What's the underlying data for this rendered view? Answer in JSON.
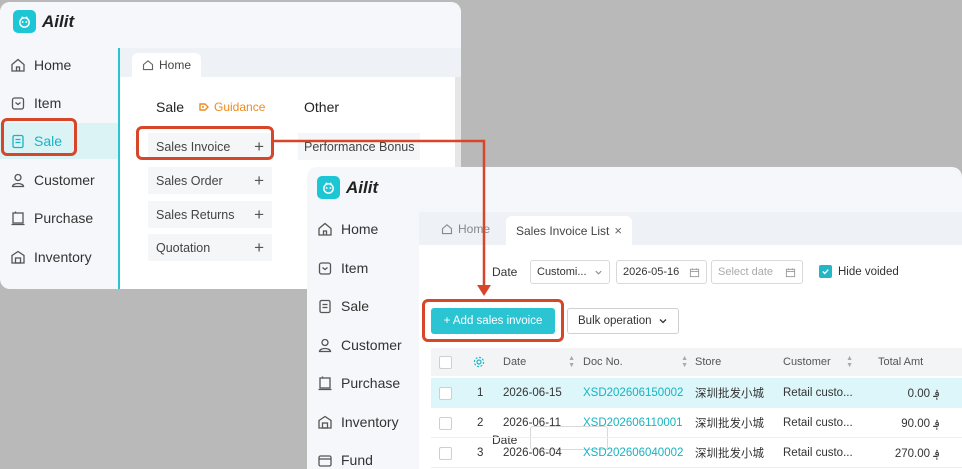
{
  "app": {
    "name": "Ailit"
  },
  "window1": {
    "nav": [
      {
        "label": "Home",
        "icon": "home-icon"
      },
      {
        "label": "Item",
        "icon": "item-icon"
      },
      {
        "label": "Sale",
        "icon": "sale-icon",
        "active": true
      },
      {
        "label": "Customer",
        "icon": "customer-icon"
      },
      {
        "label": "Purchase",
        "icon": "purchase-icon"
      },
      {
        "label": "Inventory",
        "icon": "inventory-icon"
      }
    ],
    "tab_home": "Home",
    "sale_heading": "Sale",
    "guidance": "Guidance",
    "other_heading": "Other",
    "sale_menu": [
      "Sales Invoice",
      "Sales Order",
      "Sales Returns",
      "Quotation"
    ],
    "other_menu": [
      "Performance Bonus"
    ]
  },
  "window2": {
    "nav": [
      {
        "label": "Home",
        "icon": "home-icon"
      },
      {
        "label": "Item",
        "icon": "item-icon"
      },
      {
        "label": "Sale",
        "icon": "sale-icon"
      },
      {
        "label": "Customer",
        "icon": "customer-icon"
      },
      {
        "label": "Purchase",
        "icon": "purchase-icon"
      },
      {
        "label": "Inventory",
        "icon": "inventory-icon"
      },
      {
        "label": "Fund",
        "icon": "fund-icon"
      }
    ],
    "tabs": [
      {
        "label": "Home"
      },
      {
        "label": "Sales Invoice List",
        "active": true
      }
    ],
    "filter": {
      "date_label": "Date",
      "range_select": "Customi...",
      "start_date": "2026-05-16",
      "end_placeholder": "Select date",
      "hide_voided": "Hide voided"
    },
    "buttons": {
      "add": "+ Add sales invoice",
      "bulk": "Bulk operation"
    },
    "table": {
      "columns": [
        "Date",
        "Doc No.",
        "Store",
        "Customer",
        "Total Amt"
      ],
      "rows": [
        {
          "no": "1",
          "date": "2026-06-15",
          "doc": "XSD202606150002",
          "store": "深圳批发小城",
          "customer": "Retail custo...",
          "amount": "0.00 ؋"
        },
        {
          "no": "2",
          "date": "2026-06-11",
          "doc": "XSD202606110001",
          "store": "深圳批发小城",
          "customer": "Retail custo...",
          "amount": "90.00 ؋"
        },
        {
          "no": "3",
          "date": "2026-06-04",
          "doc": "XSD202606040002",
          "store": "深圳批发小城",
          "customer": "Retail custo...",
          "amount": "270.00 ؋"
        }
      ]
    }
  },
  "colors": {
    "accent": "#2bc4d3",
    "annotation": "#d8462a",
    "guidance": "#f08a1c"
  }
}
